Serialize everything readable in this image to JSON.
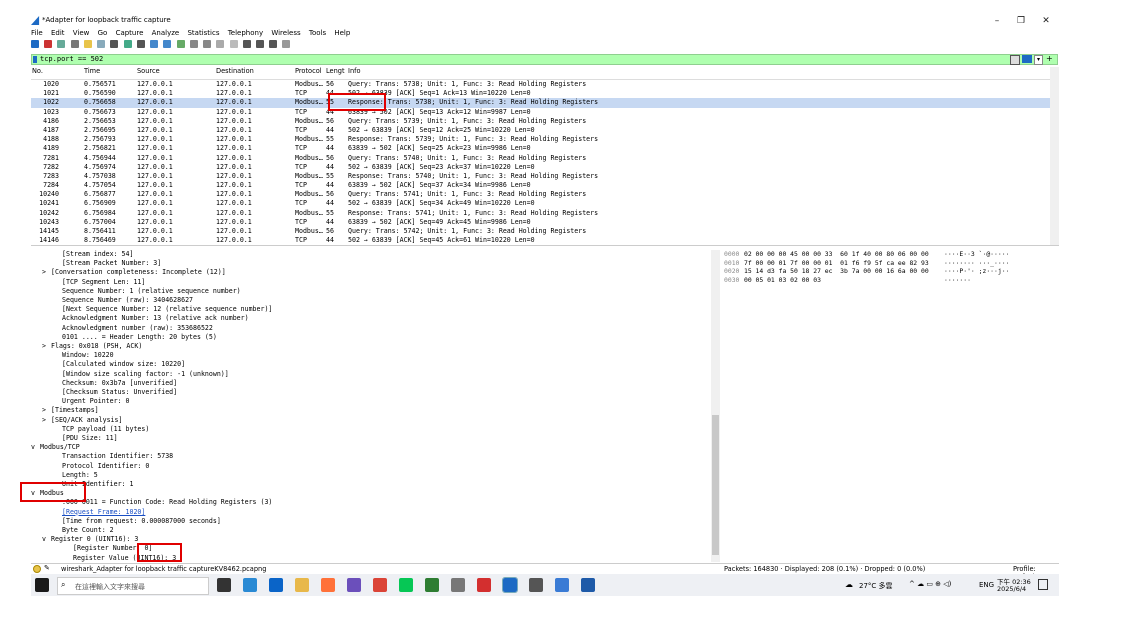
{
  "window": {
    "title": "*Adapter for loopback traffic capture",
    "controls": {
      "minimize": "–",
      "maximize": "❐",
      "close": "✕"
    }
  },
  "menu": [
    "File",
    "Edit",
    "View",
    "Go",
    "Capture",
    "Analyze",
    "Statistics",
    "Telephony",
    "Wireless",
    "Tools",
    "Help"
  ],
  "filter": {
    "value": "tcp.port == 502"
  },
  "packet_list": {
    "headers": [
      "No.",
      "Time",
      "Source",
      "Destination",
      "Protocol",
      "Lengt",
      "Info"
    ],
    "rows": [
      [
        "1020",
        "0.756571",
        "127.0.0.1",
        "127.0.0.1",
        "Modbus…",
        "56",
        "   Query: Trans:  5738; Unit:   1, Func:   3: Read Holding Registers"
      ],
      [
        "1021",
        "0.756590",
        "127.0.0.1",
        "127.0.0.1",
        "TCP",
        "44",
        "502 → 63839 [ACK] Seq=1 Ack=13 Win=10220 Len=0"
      ],
      [
        "1022",
        "0.756658",
        "127.0.0.1",
        "127.0.0.1",
        "Modbus…",
        "55",
        "Response: Trans:  5738; Unit:   1, Func:   3: Read Holding Registers"
      ],
      [
        "1023",
        "0.756673",
        "127.0.0.1",
        "127.0.0.1",
        "TCP",
        "44",
        "63839 → 502 [ACK] Seq=13 Ack=12 Win=9987 Len=0"
      ],
      [
        "4186",
        "2.756653",
        "127.0.0.1",
        "127.0.0.1",
        "Modbus…",
        "56",
        "   Query: Trans:  5739; Unit:   1, Func:   3: Read Holding Registers"
      ],
      [
        "4187",
        "2.756695",
        "127.0.0.1",
        "127.0.0.1",
        "TCP",
        "44",
        "502 → 63839 [ACK] Seq=12 Ack=25 Win=10220 Len=0"
      ],
      [
        "4188",
        "2.756793",
        "127.0.0.1",
        "127.0.0.1",
        "Modbus…",
        "55",
        "Response: Trans:  5739; Unit:   1, Func:   3: Read Holding Registers"
      ],
      [
        "4189",
        "2.756821",
        "127.0.0.1",
        "127.0.0.1",
        "TCP",
        "44",
        "63839 → 502 [ACK] Seq=25 Ack=23 Win=9986 Len=0"
      ],
      [
        "7281",
        "4.756944",
        "127.0.0.1",
        "127.0.0.1",
        "Modbus…",
        "56",
        "   Query: Trans:  5740; Unit:   1, Func:   3: Read Holding Registers"
      ],
      [
        "7282",
        "4.756974",
        "127.0.0.1",
        "127.0.0.1",
        "TCP",
        "44",
        "502 → 63839 [ACK] Seq=23 Ack=37 Win=10220 Len=0"
      ],
      [
        "7283",
        "4.757038",
        "127.0.0.1",
        "127.0.0.1",
        "Modbus…",
        "55",
        "Response: Trans:  5740; Unit:   1, Func:   3: Read Holding Registers"
      ],
      [
        "7284",
        "4.757054",
        "127.0.0.1",
        "127.0.0.1",
        "TCP",
        "44",
        "63839 → 502 [ACK] Seq=37 Ack=34 Win=9986 Len=0"
      ],
      [
        "10240",
        "6.756877",
        "127.0.0.1",
        "127.0.0.1",
        "Modbus…",
        "56",
        "   Query: Trans:  5741; Unit:   1, Func:   3: Read Holding Registers"
      ],
      [
        "10241",
        "6.756909",
        "127.0.0.1",
        "127.0.0.1",
        "TCP",
        "44",
        "502 → 63839 [ACK] Seq=34 Ack=49 Win=10220 Len=0"
      ],
      [
        "10242",
        "6.756984",
        "127.0.0.1",
        "127.0.0.1",
        "Modbus…",
        "55",
        "Response: Trans:  5741; Unit:   1, Func:   3: Read Holding Registers"
      ],
      [
        "10243",
        "6.757004",
        "127.0.0.1",
        "127.0.0.1",
        "TCP",
        "44",
        "63839 → 502 [ACK] Seq=49 Ack=45 Win=9986 Len=0"
      ],
      [
        "14145",
        "8.756411",
        "127.0.0.1",
        "127.0.0.1",
        "Modbus…",
        "56",
        "   Query: Trans:  5742; Unit:   1, Func:   3: Read Holding Registers"
      ],
      [
        "14146",
        "8.756469",
        "127.0.0.1",
        "127.0.0.1",
        "TCP",
        "44",
        "502 → 63839 [ACK] Seq=45 Ack=61 Win=10220 Len=0"
      ]
    ]
  },
  "details": [
    {
      "indent": 2,
      "arrow": "",
      "text": "[Stream index: 54]"
    },
    {
      "indent": 2,
      "arrow": "",
      "text": "[Stream Packet Number: 3]"
    },
    {
      "indent": 1,
      "arrow": ">",
      "text": "[Conversation completeness: Incomplete (12)]"
    },
    {
      "indent": 2,
      "arrow": "",
      "text": "[TCP Segment Len: 11]"
    },
    {
      "indent": 2,
      "arrow": "",
      "text": "Sequence Number: 1    (relative sequence number)"
    },
    {
      "indent": 2,
      "arrow": "",
      "text": "Sequence Number (raw): 3404628627"
    },
    {
      "indent": 2,
      "arrow": "",
      "text": "[Next Sequence Number: 12    (relative sequence number)]"
    },
    {
      "indent": 2,
      "arrow": "",
      "text": "Acknowledgment Number: 13    (relative ack number)"
    },
    {
      "indent": 2,
      "arrow": "",
      "text": "Acknowledgment number (raw): 353686522"
    },
    {
      "indent": 2,
      "arrow": "",
      "text": "0101 .... = Header Length: 20 bytes (5)"
    },
    {
      "indent": 1,
      "arrow": ">",
      "text": "Flags: 0x018 (PSH, ACK)"
    },
    {
      "indent": 2,
      "arrow": "",
      "text": "Window: 10220"
    },
    {
      "indent": 2,
      "arrow": "",
      "text": "[Calculated window size: 10220]"
    },
    {
      "indent": 2,
      "arrow": "",
      "text": "[Window size scaling factor: -1 (unknown)]"
    },
    {
      "indent": 2,
      "arrow": "",
      "text": "Checksum: 0x3b7a [unverified]"
    },
    {
      "indent": 2,
      "arrow": "",
      "text": "[Checksum Status: Unverified]"
    },
    {
      "indent": 2,
      "arrow": "",
      "text": "Urgent Pointer: 0"
    },
    {
      "indent": 1,
      "arrow": ">",
      "text": "[Timestamps]"
    },
    {
      "indent": 1,
      "arrow": ">",
      "text": "[SEQ/ACK analysis]"
    },
    {
      "indent": 2,
      "arrow": "",
      "text": "TCP payload (11 bytes)"
    },
    {
      "indent": 2,
      "arrow": "",
      "text": "[PDU Size: 11]"
    },
    {
      "indent": 0,
      "arrow": "v",
      "text": "Modbus/TCP"
    },
    {
      "indent": 2,
      "arrow": "",
      "text": "Transaction Identifier: 5738"
    },
    {
      "indent": 2,
      "arrow": "",
      "text": "Protocol Identifier: 0"
    },
    {
      "indent": 2,
      "arrow": "",
      "text": "Length: 5"
    },
    {
      "indent": 2,
      "arrow": "",
      "text": "Unit Identifier: 1"
    },
    {
      "indent": 0,
      "arrow": "v",
      "text": "Modbus",
      "hl": true
    },
    {
      "indent": 2,
      "arrow": "",
      "text": ".000 0011 = Function Code: Read Holding Registers (3)"
    },
    {
      "indent": 2,
      "arrow": "",
      "text": "[Request Frame: 1020]",
      "link": true
    },
    {
      "indent": 2,
      "arrow": "",
      "text": "[Time from request: 0.000087000 seconds]"
    },
    {
      "indent": 2,
      "arrow": "",
      "text": "Byte Count: 2"
    },
    {
      "indent": 1,
      "arrow": "v",
      "text": "Register 0 (UINT16): 3"
    },
    {
      "indent": 3,
      "arrow": "",
      "text": "[Register Number: 0]"
    },
    {
      "indent": 3,
      "arrow": "",
      "text": "Register Value (UINT16): 3"
    }
  ],
  "bytes": [
    {
      "off": "0000",
      "hex": "02 00 00 00 45 00 00 33  60 1f 40 00 80 06 00 00",
      "ascii": "····E··3 `·@·····"
    },
    {
      "off": "0010",
      "hex": "7f 00 00 01 7f 00 00 01  01 f6 f9 5f ca ee 82 93",
      "ascii": "········ ···_····"
    },
    {
      "off": "0020",
      "hex": "15 14 d3 fa 50 18 27 ec  3b 7a 00 00 16 6a 00 00",
      "ascii": "····P·'· ;z···j··"
    },
    {
      "off": "0030",
      "hex": "00 05 01 03 02 00 03",
      "ascii": "·······"
    }
  ],
  "status": {
    "file": "wireshark_Adapter for loopback traffic captureKV8462.pcapng",
    "packets": "Packets: 164830 · Displayed: 208 (0.1%) · Dropped: 0 (0.0%)",
    "profile": "Profile: Default"
  },
  "taskbar": {
    "search_placeholder": "在這裡輸入文字來搜尋",
    "weather": "27°C 多雲",
    "lang": "ENG",
    "time": "下午 02:36",
    "date": "2025/6/4"
  },
  "colors": {
    "selected_row": "#c6d8f2",
    "filter_bg": "#afffaf",
    "highlight": "#e00000",
    "taskbar": "#eef0f4"
  }
}
